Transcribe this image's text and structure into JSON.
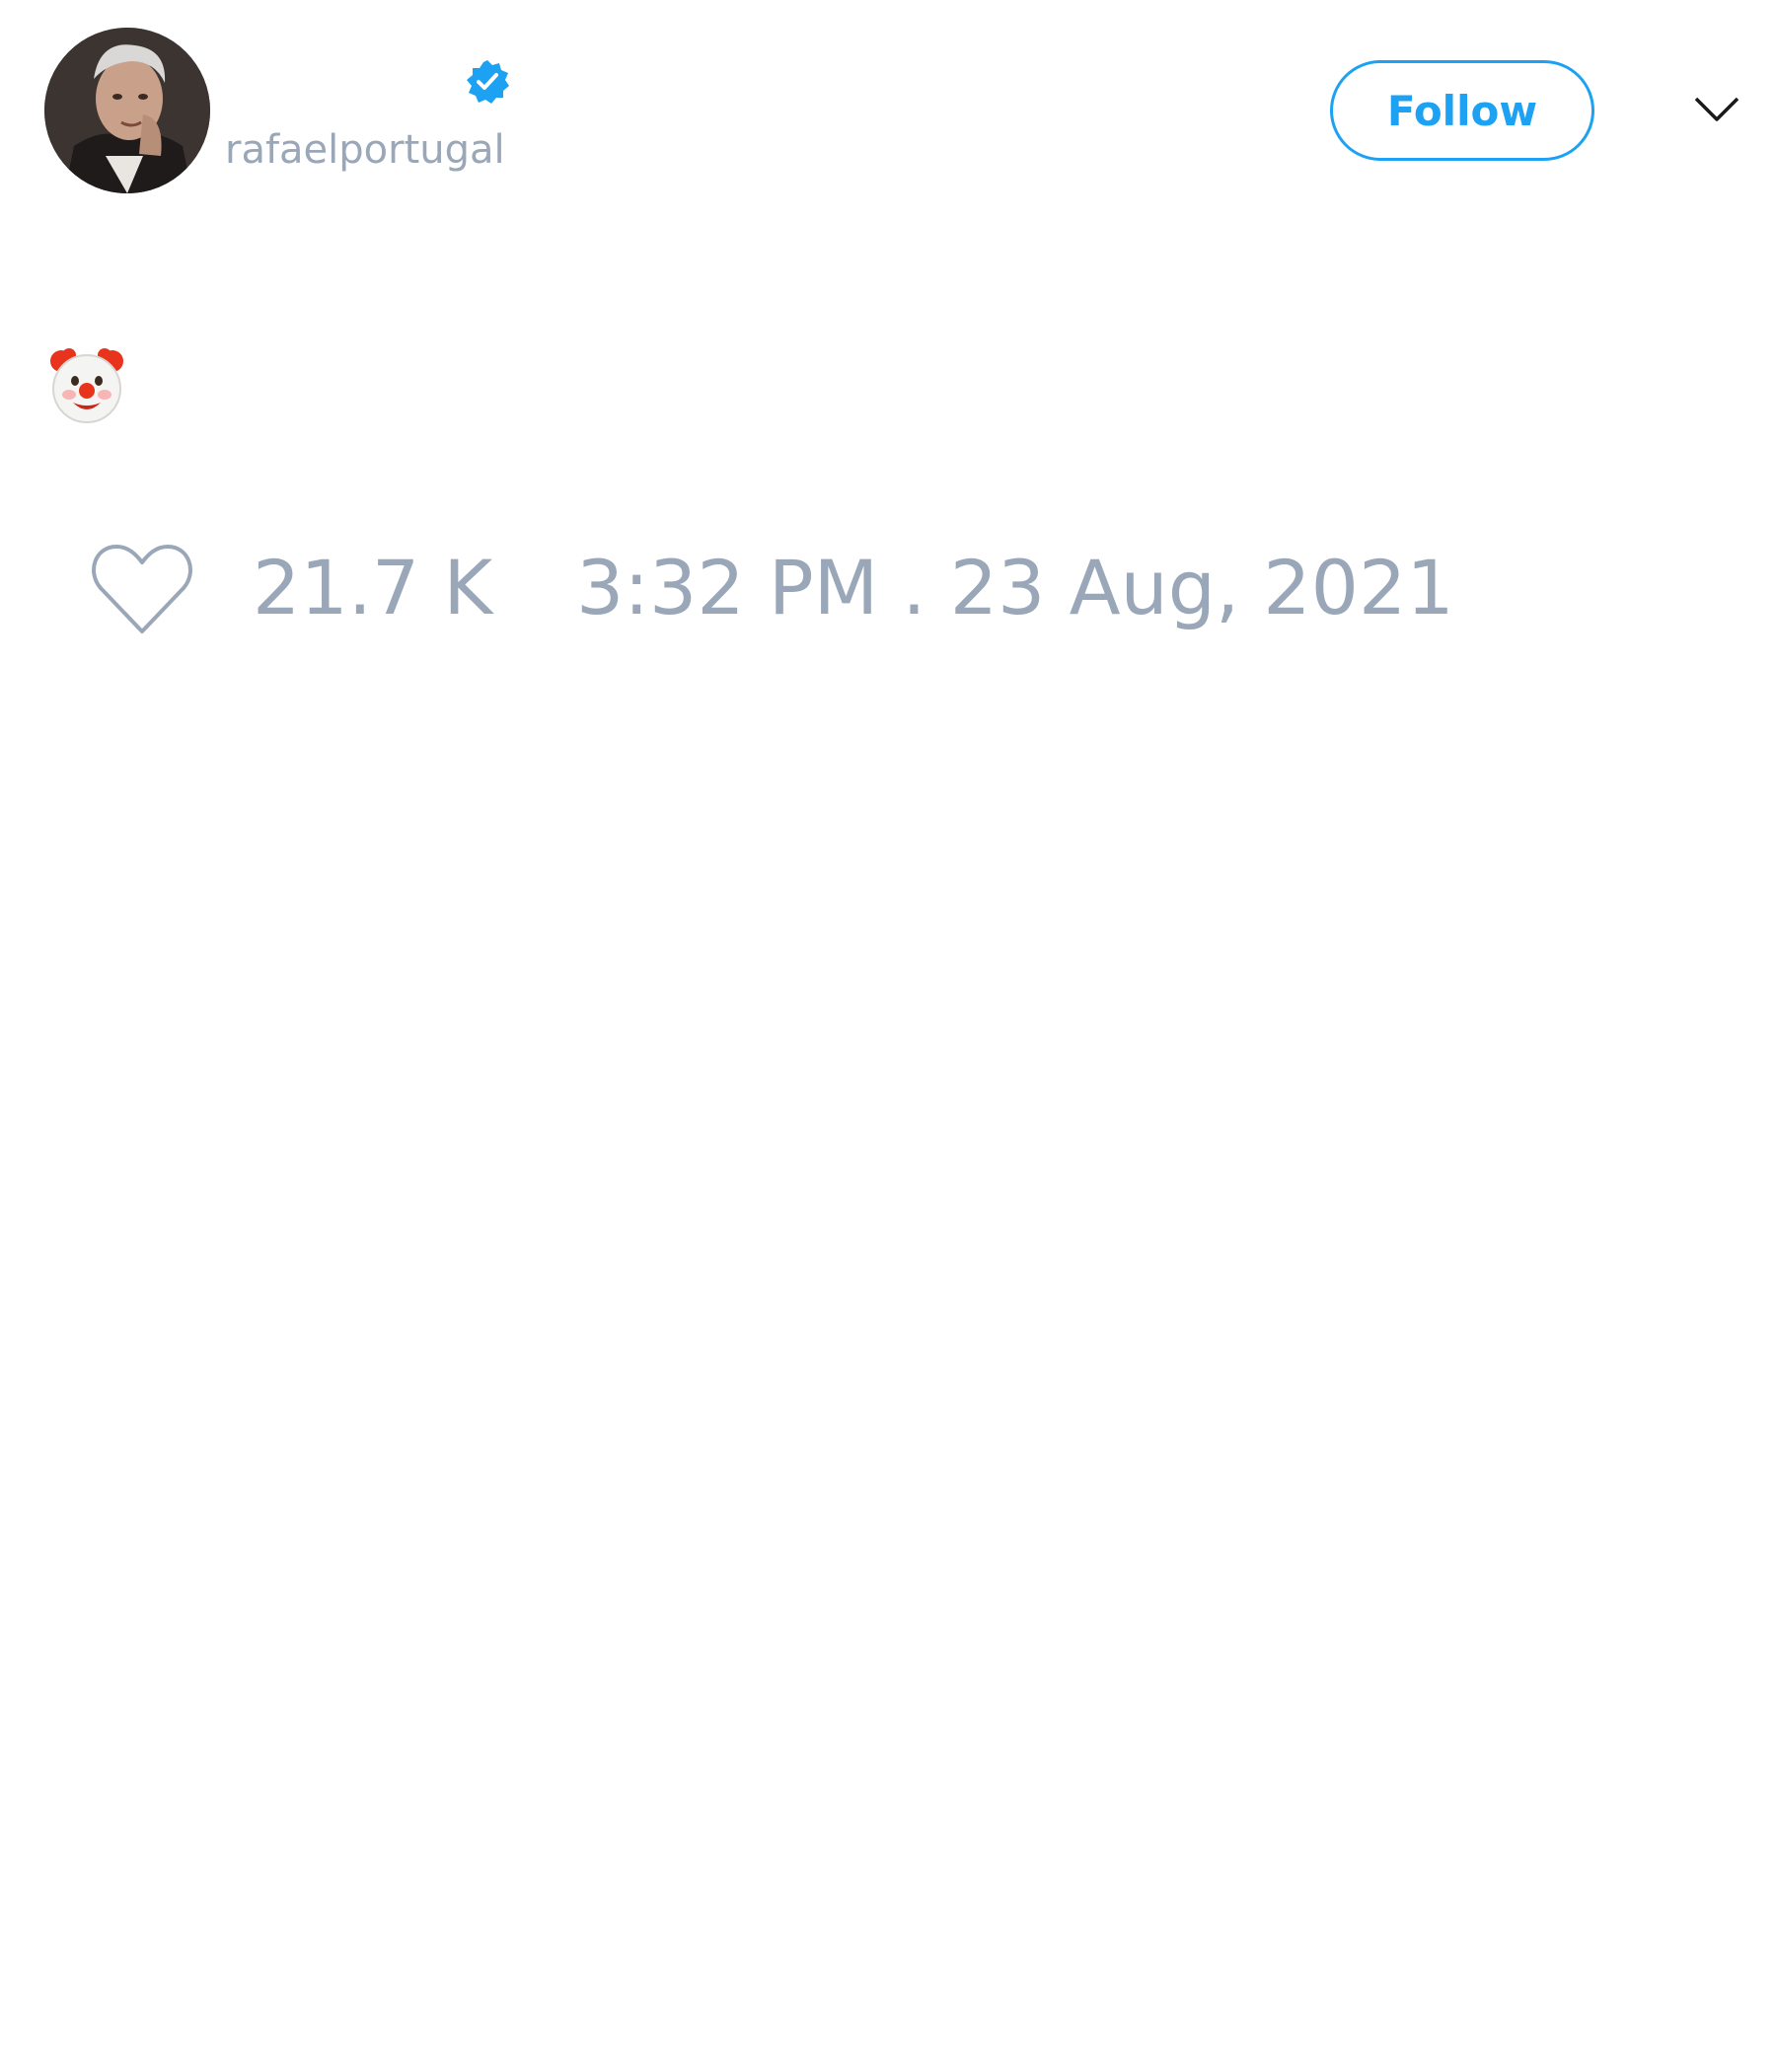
{
  "author": {
    "handle": "rafaelportugal",
    "verified": true,
    "avatar_icon": "profile-photo"
  },
  "actions": {
    "follow_label": "Follow",
    "menu_icon": "chevron-down-icon"
  },
  "tweet": {
    "content_icon": "clown-face-emoji",
    "likes": "21.7 K",
    "timestamp": "3:32 PM . 23 Aug, 2021"
  },
  "colors": {
    "accent": "#1da1f2",
    "muted_text": "#9aa7b8",
    "background": "#ffffff"
  }
}
